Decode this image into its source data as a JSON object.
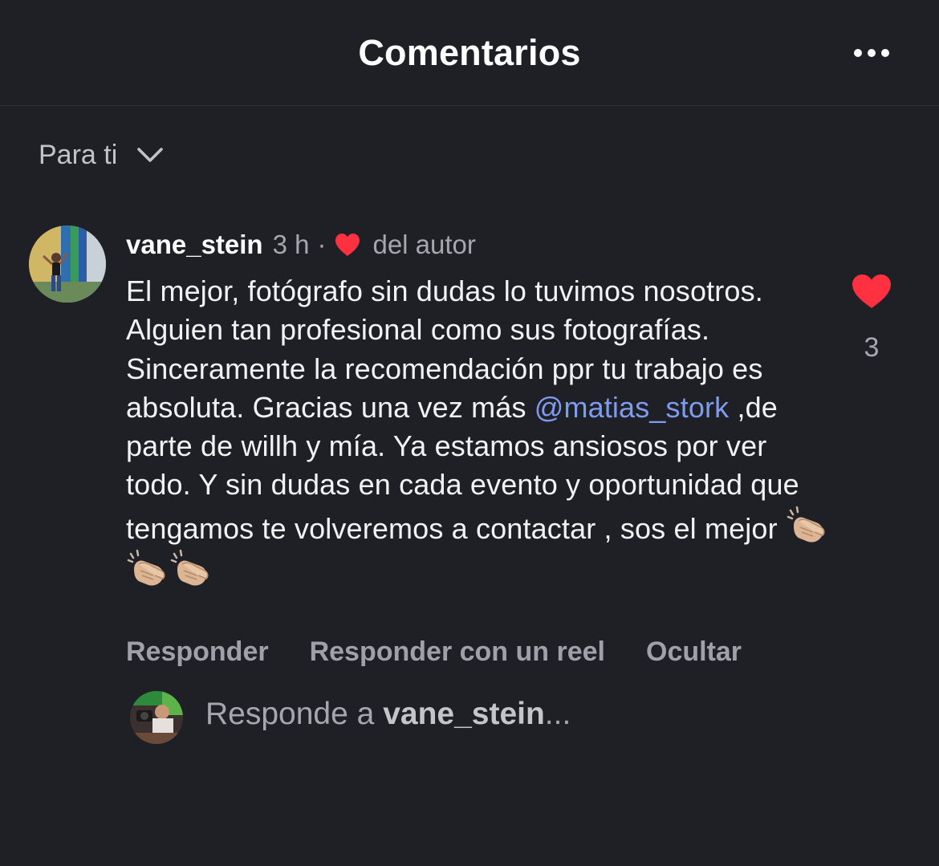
{
  "header": {
    "title": "Comentarios",
    "more_icon": "more-horizontal-icon"
  },
  "filter": {
    "label": "Para ti",
    "icon": "chevron-down-icon"
  },
  "comment": {
    "username": "vane_stein",
    "time": "3 h",
    "separator": "·",
    "author_like_label": "del autor",
    "text_before_mention": "El mejor, fotógrafo sin dudas lo tuvimos nosotros.  Alguien tan profesional como sus fotografías.  Sinceramente la recomendación ppr tu trabajo es absoluta. Gracias una vez más ",
    "mention": "@matias_stork",
    "text_after_mention": " ,de parte de willh y mía.  Ya estamos ansiosos por ver todo.  Y sin dudas en cada evento y oportunidad que tengamos te volveremos a contactar , sos el mejor ",
    "emojis": [
      "clapping-hands-icon",
      "clapping-hands-icon",
      "clapping-hands-icon"
    ],
    "likes": "3",
    "liked": true,
    "actions": {
      "reply": "Responder",
      "reply_reel": "Responder con un reel",
      "hide": "Ocultar"
    }
  },
  "composer": {
    "prefix": "Responde a",
    "username": "vane_stein",
    "suffix": "..."
  },
  "colors": {
    "background": "#1f2026",
    "heart": "#ff3040",
    "mention": "#7f9bf0",
    "secondary_text": "#a6a7ae"
  }
}
